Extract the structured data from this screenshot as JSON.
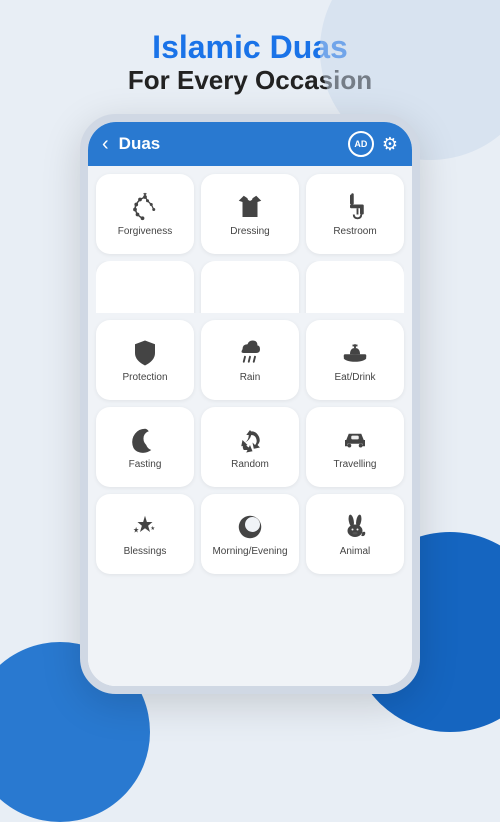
{
  "header": {
    "main_title": "Islamic Duas",
    "sub_title": "For Every Occasion"
  },
  "app_bar": {
    "title": "Duas",
    "back_label": "‹",
    "ad_text": "AD",
    "gear_symbol": "⚙"
  },
  "grid_items": [
    {
      "id": "forgiveness",
      "label": "Forgiveness",
      "icon": "rosary"
    },
    {
      "id": "dressing",
      "label": "Dressing",
      "icon": "shirt"
    },
    {
      "id": "restroom",
      "label": "Restroom",
      "icon": "faucet"
    },
    {
      "id": "partial1a",
      "label": "",
      "icon": "mosque"
    },
    {
      "id": "partial1b",
      "label": "",
      "icon": "shower"
    },
    {
      "id": "partial1c",
      "label": "",
      "icon": "people"
    },
    {
      "id": "protection",
      "label": "Protection",
      "icon": "shield"
    },
    {
      "id": "rain",
      "label": "Rain",
      "icon": "rain"
    },
    {
      "id": "eat-drink",
      "label": "Eat/Drink",
      "icon": "food"
    },
    {
      "id": "fasting",
      "label": "Fasting",
      "icon": "crescent"
    },
    {
      "id": "random",
      "label": "Random",
      "icon": "recycle"
    },
    {
      "id": "travelling",
      "label": "Travelling",
      "icon": "car"
    },
    {
      "id": "blessings",
      "label": "Blessings",
      "icon": "stars"
    },
    {
      "id": "morning-evening",
      "label": "Morning/Evening",
      "icon": "moon-face"
    },
    {
      "id": "animal",
      "label": "Animal",
      "icon": "rabbit"
    }
  ],
  "colors": {
    "accent": "#2979d0",
    "icon_color": "#444444",
    "bg": "#e8eef5",
    "card_bg": "#ffffff"
  }
}
